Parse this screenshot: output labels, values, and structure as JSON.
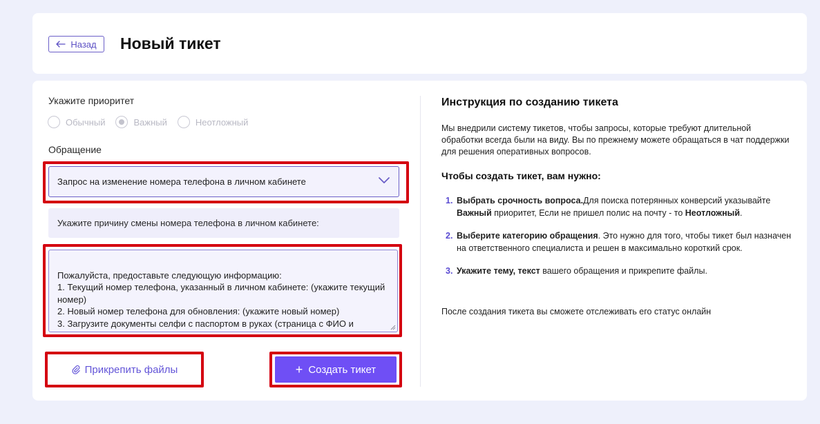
{
  "header": {
    "back_label": "Назад",
    "title": "Новый тикет"
  },
  "form": {
    "priority_label": "Укажите приоритет",
    "priority_options": [
      {
        "label": "Обычный",
        "selected": false
      },
      {
        "label": "Важный",
        "selected": true
      },
      {
        "label": "Неотложный",
        "selected": false
      }
    ],
    "request_label": "Обращение",
    "request_value": "Запрос на изменение номера телефона в личном кабинете",
    "hint": "Укажите причину смены номера телефона в личном кабинете:",
    "message_value": "Пожалуйста, предоставьте следующую информацию:\n1. Текущий номер телефона, указанный в личном кабинете: (укажите текущий номер)\n2. Новый номер телефона для обновления: (укажите новый номер)\n3. Загрузите документы селфи с паспортом в руках (страница с ФИО и данными, указанными в реквизитах) + фото паспорта.",
    "attach_label": "Прикрепить файлы",
    "create_label": "Создать тикет"
  },
  "instructions": {
    "title": "Инструкция по созданию тикета",
    "intro": "Мы внедрили систему тикетов, чтобы запросы, которые требуют длительной обработки всегда были на виду. Вы по прежнему можете обращаться в чат поддержки для решения оперативных вопросов.",
    "subtitle": "Чтобы создать тикет, вам нужно:",
    "steps": [
      {
        "num": "1.",
        "bold1": "Выбрать срочность вопроса.",
        "text1": "Для поиска потерянных конверсий указывайте ",
        "bold2": "Важный",
        "text2": " приоритет, Если не пришел полис на почту - то ",
        "bold3": "Неотложный",
        "text3": "."
      },
      {
        "num": "2.",
        "bold1": "Выберите категорию обращения",
        "text1": ". Это нужно для того, чтобы тикет был назначен на ответственного специалиста и решен в максимально короткий срок."
      },
      {
        "num": "3.",
        "bold1": "Укажите тему, текст",
        "text1": " вашего обращения и прикрепите файлы."
      }
    ],
    "after": "После создания тикета вы сможете отслеживать его статус онлайн"
  },
  "colors": {
    "accent": "#6f4ff5",
    "highlight": "#d40010",
    "background": "#eef0fb"
  }
}
